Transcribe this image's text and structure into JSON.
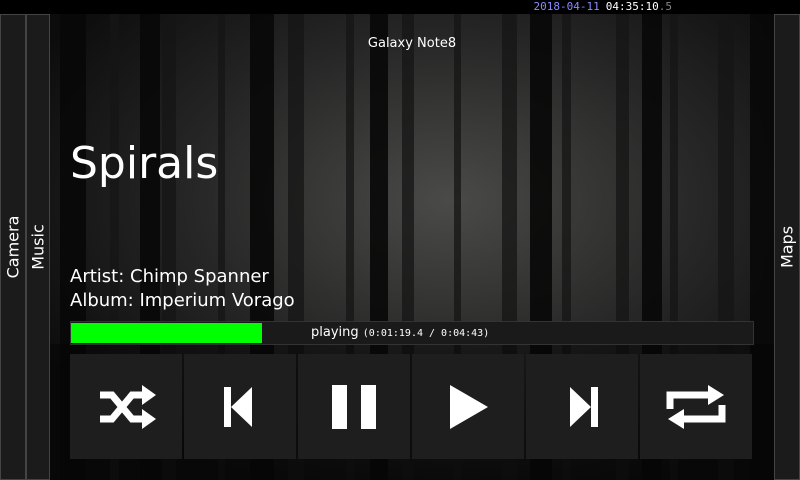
{
  "status_bar": {
    "date": "2018-04-11",
    "time": "04:35:10",
    "fraction": ".5"
  },
  "side_tabs": {
    "left": [
      "Camera",
      "Music"
    ],
    "right": "Maps"
  },
  "device_name": "Galaxy Note8",
  "track": {
    "title": "Spirals",
    "artist_label": "Artist: Chimp Spanner",
    "album_label": "Album: Imperium Vorago"
  },
  "playback": {
    "state": "playing",
    "timecode": "(0:01:19.4 / 0:04:43)",
    "progress_fraction": 0.28,
    "progress_color": "#00ff00"
  },
  "controls": [
    "shuffle-icon",
    "previous-icon",
    "pause-icon",
    "play-icon",
    "next-icon",
    "repeat-icon"
  ]
}
